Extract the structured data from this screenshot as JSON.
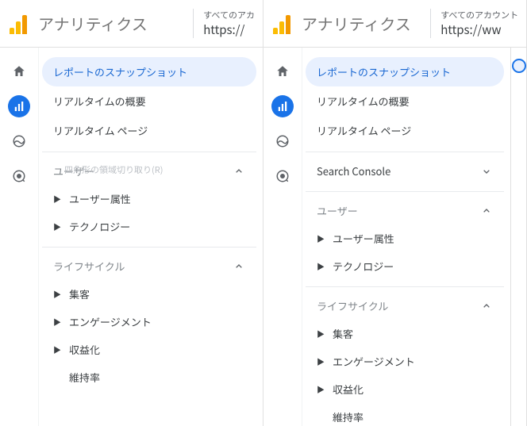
{
  "left": {
    "header": {
      "title": "アナリティクス",
      "accountLabel": "すべてのアカ",
      "accountUrl": "https://"
    },
    "nav": {
      "snapshot": "レポートのスナップショット",
      "realtimeOverview": "リアルタイムの概要",
      "realtimePages": "リアルタイム ページ",
      "user": {
        "title": "ユーザー",
        "hint": "四角形の領域切り取り(R)",
        "attributes": "ユーザー属性",
        "technology": "テクノロジー"
      },
      "lifecycle": {
        "title": "ライフサイクル",
        "acquisition": "集客",
        "engagement": "エンゲージメント",
        "monetization": "収益化",
        "retention": "維持率"
      }
    }
  },
  "right": {
    "header": {
      "title": "アナリティクス",
      "accountLabel": "すべてのアカウント",
      "accountUrl": "https://ww"
    },
    "nav": {
      "snapshot": "レポートのスナップショット",
      "realtimeOverview": "リアルタイムの概要",
      "realtimePages": "リアルタイム ページ",
      "searchConsole": {
        "title": "Search Console"
      },
      "user": {
        "title": "ユーザー",
        "attributes": "ユーザー属性",
        "technology": "テクノロジー"
      },
      "lifecycle": {
        "title": "ライフサイクル",
        "acquisition": "集客",
        "engagement": "エンゲージメント",
        "monetization": "収益化",
        "retention": "維持率"
      }
    }
  }
}
